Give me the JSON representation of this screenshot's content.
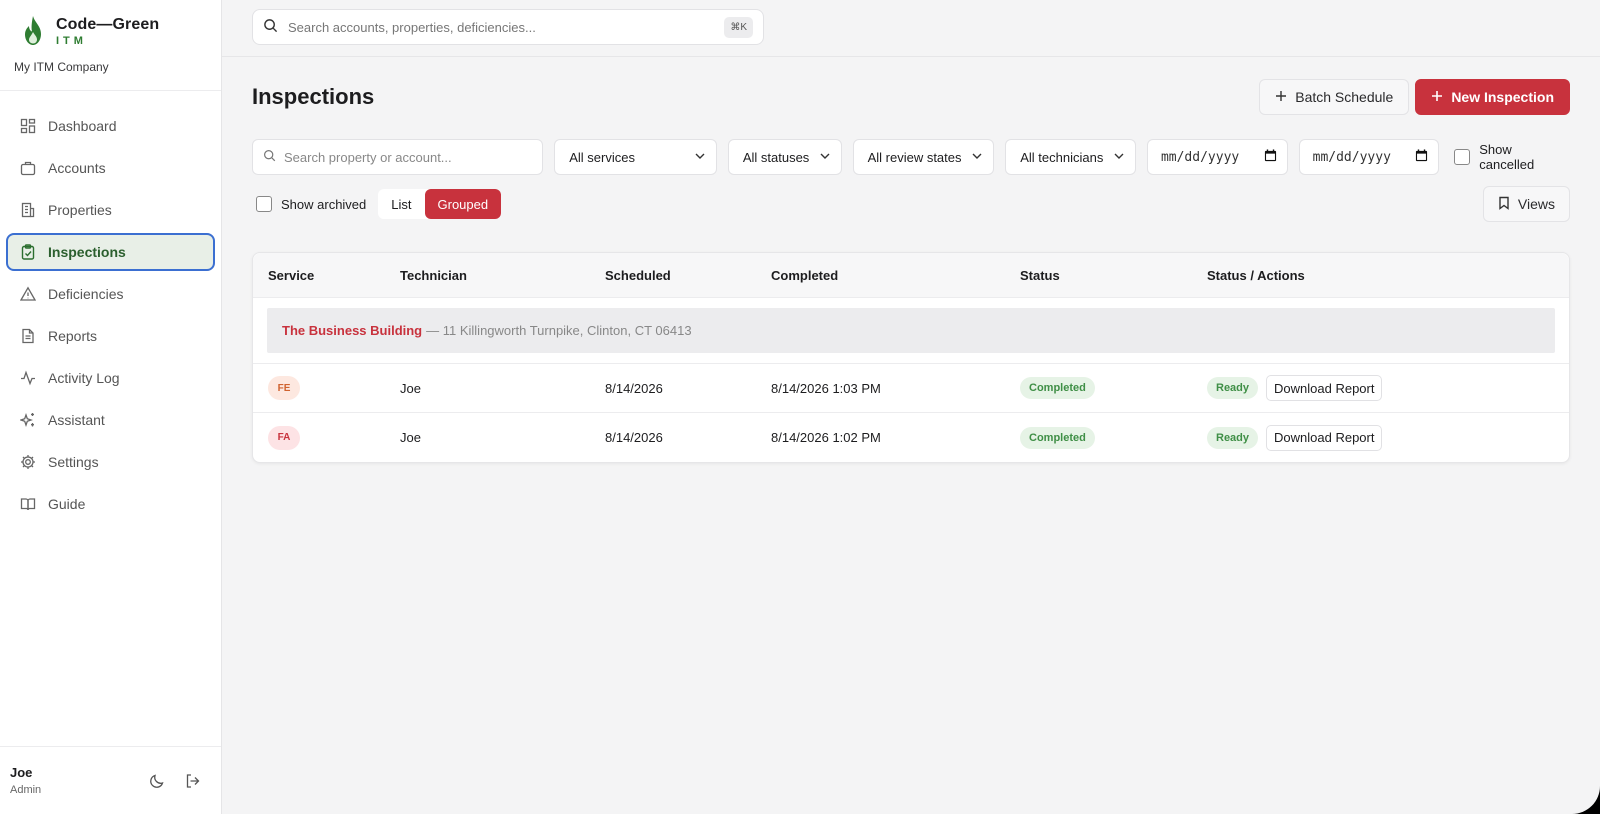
{
  "brand": {
    "name": "Code—Green",
    "sub": "ITM",
    "company": "My ITM Company",
    "logo_color": "#2f7d32"
  },
  "sidebar": {
    "items": [
      {
        "label": "Dashboard",
        "icon": "dashboard-icon"
      },
      {
        "label": "Accounts",
        "icon": "briefcase-icon"
      },
      {
        "label": "Properties",
        "icon": "building-icon"
      },
      {
        "label": "Inspections",
        "icon": "clipboard-check-icon",
        "active": true
      },
      {
        "label": "Deficiencies",
        "icon": "warning-triangle-icon"
      },
      {
        "label": "Reports",
        "icon": "file-text-icon"
      },
      {
        "label": "Activity Log",
        "icon": "activity-icon"
      },
      {
        "label": "Assistant",
        "icon": "sparkles-icon"
      },
      {
        "label": "Settings",
        "icon": "gear-icon"
      },
      {
        "label": "Guide",
        "icon": "book-open-icon"
      }
    ]
  },
  "user": {
    "name": "Joe",
    "role": "Admin"
  },
  "topbar": {
    "search_placeholder": "Search accounts, properties, deficiencies...",
    "shortcut": "⌘K"
  },
  "page": {
    "title": "Inspections",
    "batch_label": "Batch Schedule",
    "new_label": "New Inspection"
  },
  "filters": {
    "search_placeholder": "Search property or account...",
    "services": "All services",
    "statuses": "All statuses",
    "review_states": "All review states",
    "technicians": "All technicians",
    "date_from": "mm/dd/yyyy",
    "date_to": "mm/dd/yyyy",
    "show_cancelled": "Show cancelled",
    "show_archived": "Show archived",
    "view_list": "List",
    "view_grouped": "Grouped",
    "views": "Views"
  },
  "table": {
    "headers": [
      "Service",
      "Technician",
      "Scheduled",
      "Completed",
      "Status",
      "Status / Actions"
    ],
    "group": {
      "name": "The Business Building",
      "address": "— 11 Killingworth Turnpike, Clinton, CT 06413"
    },
    "rows": [
      {
        "service": "FE",
        "service_bg": "#fde8e0",
        "service_color": "#d0622f",
        "technician": "Joe",
        "scheduled": "8/14/2026",
        "completed": "8/14/2026 1:03 PM",
        "status": "Completed",
        "ready": "Ready",
        "action": "Download Report"
      },
      {
        "service": "FA",
        "service_bg": "#fde3e5",
        "service_color": "#c8323d",
        "technician": "Joe",
        "scheduled": "8/14/2026",
        "completed": "8/14/2026 1:02 PM",
        "status": "Completed",
        "ready": "Ready",
        "action": "Download Report"
      }
    ]
  },
  "colors": {
    "accent": "#c8323d",
    "brand_green": "#2f7d32",
    "success": "#3f8f46"
  }
}
